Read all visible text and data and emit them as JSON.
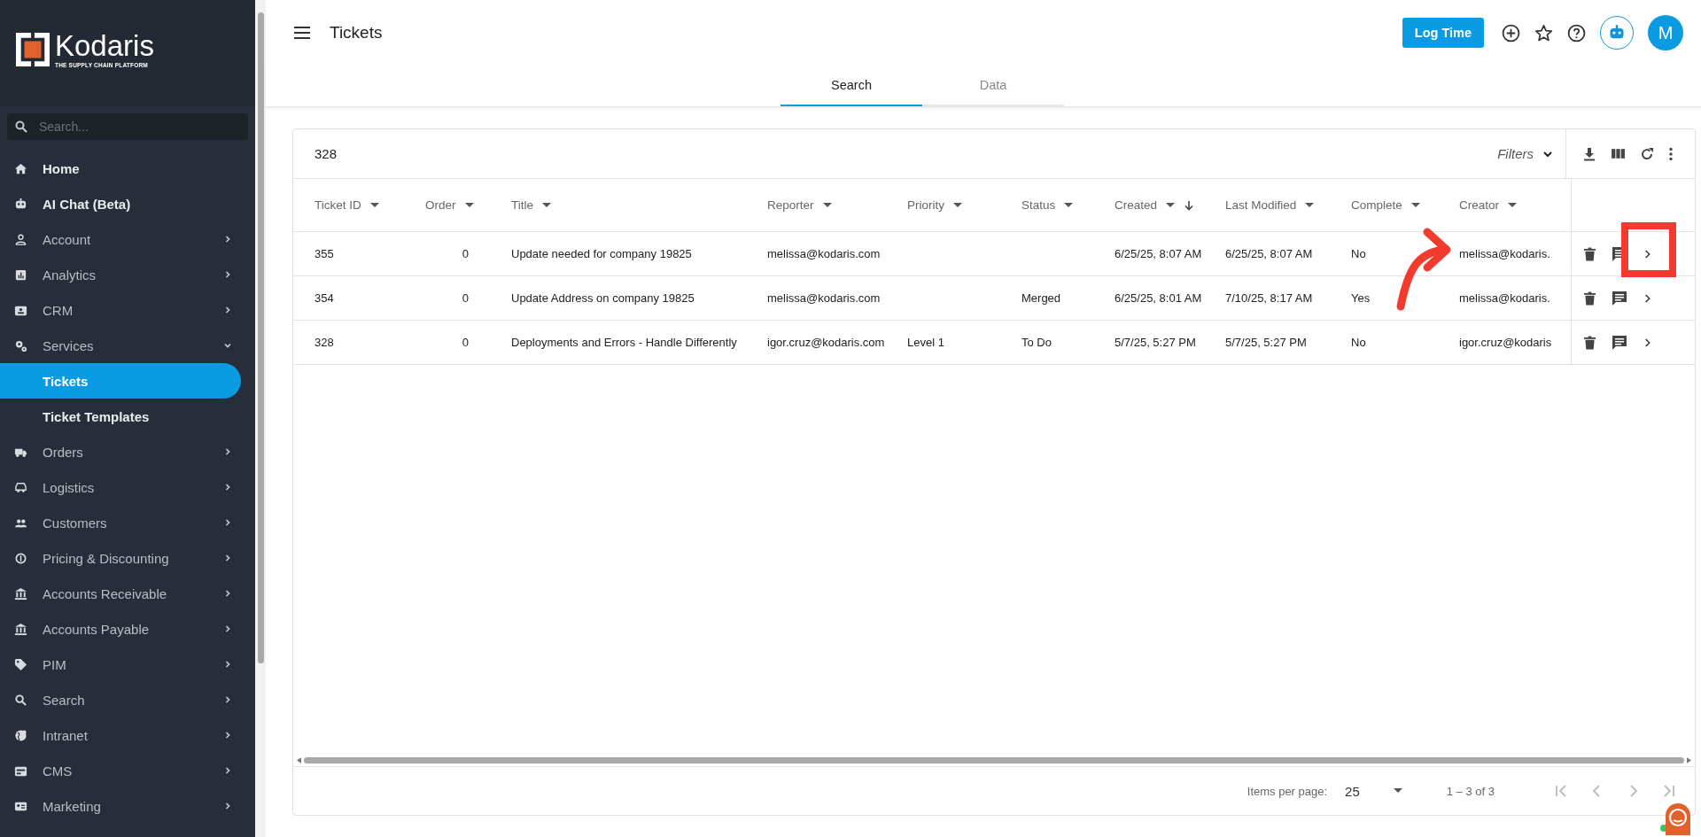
{
  "sidebar": {
    "logo": {
      "name": "Kodaris",
      "tagline": "THE SUPPLY CHAIN PLATFORM"
    },
    "search": {
      "placeholder": "Search..."
    },
    "items": [
      {
        "label": "Home",
        "kind": "link",
        "selected": false
      },
      {
        "label": "AI Chat (Beta)",
        "kind": "link",
        "selected": false
      },
      {
        "label": "Account",
        "kind": "group",
        "expanded": false
      },
      {
        "label": "Analytics",
        "kind": "group",
        "expanded": false
      },
      {
        "label": "CRM",
        "kind": "group",
        "expanded": false
      },
      {
        "label": "Services",
        "kind": "group",
        "expanded": true,
        "children": [
          {
            "label": "Tickets",
            "selected": true
          },
          {
            "label": "Ticket Templates",
            "selected": false
          }
        ]
      },
      {
        "label": "Orders",
        "kind": "group",
        "expanded": false
      },
      {
        "label": "Logistics",
        "kind": "group",
        "expanded": false
      },
      {
        "label": "Customers",
        "kind": "group",
        "expanded": false
      },
      {
        "label": "Pricing & Discounting",
        "kind": "group",
        "expanded": false
      },
      {
        "label": "Accounts Receivable",
        "kind": "group",
        "expanded": false
      },
      {
        "label": "Accounts Payable",
        "kind": "group",
        "expanded": false
      },
      {
        "label": "PIM",
        "kind": "group",
        "expanded": false
      },
      {
        "label": "Search",
        "kind": "group",
        "expanded": false
      },
      {
        "label": "Intranet",
        "kind": "group",
        "expanded": false
      },
      {
        "label": "CMS",
        "kind": "group",
        "expanded": false
      },
      {
        "label": "Marketing",
        "kind": "group",
        "expanded": false
      }
    ]
  },
  "header": {
    "title": "Tickets",
    "log_time_button": "Log Time",
    "avatar": "M"
  },
  "tabs": [
    {
      "label": "Search",
      "selected": true
    },
    {
      "label": "Data",
      "selected": false
    }
  ],
  "table": {
    "count": "328",
    "filters": "Filters",
    "columns": [
      {
        "label": "Ticket ID",
        "sorted": false
      },
      {
        "label": "Order",
        "sorted": false
      },
      {
        "label": "Title",
        "sorted": false
      },
      {
        "label": "Reporter",
        "sorted": false
      },
      {
        "label": "Priority",
        "sorted": false
      },
      {
        "label": "Status",
        "sorted": false
      },
      {
        "label": "Created",
        "sorted": true
      },
      {
        "label": "Last Modified",
        "sorted": false
      },
      {
        "label": "Complete",
        "sorted": false
      },
      {
        "label": "Creator",
        "sorted": false
      }
    ],
    "rows": [
      {
        "ticket_id": "355",
        "order": "0",
        "title": "Update needed for company 19825",
        "reporter": "melissa@kodaris.com",
        "created": "6/25/25, 8:07 AM",
        "last_modified": "6/25/25, 8:07 AM",
        "complete": "No",
        "creator": "melissa@kodaris."
      },
      {
        "ticket_id": "354",
        "order": "0",
        "title": "Update Address on company 19825",
        "reporter": "melissa@kodaris.com",
        "status": "Merged",
        "created": "6/25/25, 8:01 AM",
        "last_modified": "7/10/25, 8:17 AM",
        "complete": "Yes",
        "creator": "melissa@kodaris."
      },
      {
        "ticket_id": "328",
        "order": "0",
        "title": "Deployments and Errors - Handle Differently",
        "reporter": "igor.cruz@kodaris.com",
        "priority": "Level 1",
        "status": "To Do",
        "created": "5/7/25, 5:27 PM",
        "last_modified": "5/7/25, 5:27 PM",
        "complete": "No",
        "creator": "igor.cruz@kodaris"
      }
    ]
  },
  "pagination": {
    "items_per_page_label": "Items per page:",
    "items_per_page": "25",
    "range": "1 – 3 of 3"
  }
}
